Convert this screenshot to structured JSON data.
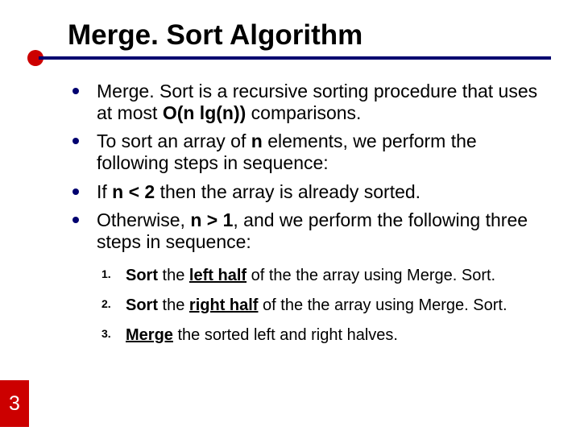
{
  "slide": {
    "number": "3",
    "title": "Merge. Sort Algorithm",
    "bullets": [
      {
        "pre": "Merge. Sort is a recursive sorting procedure that uses at most ",
        "b1": "O(n lg(n))",
        "post": " comparisons."
      },
      {
        "pre": "To sort an array of ",
        "b1": "n",
        "post": " elements, we perform the following steps in sequence:"
      },
      {
        "pre": "If ",
        "b1": "n < 2",
        "post": " then the array is already sorted."
      },
      {
        "pre": "Otherwise, ",
        "b1": "n > 1",
        "post": ", and we perform the following three steps in sequence:"
      }
    ],
    "steps": [
      {
        "num": "1.",
        "b1": "Sort",
        "mid": " the ",
        "bu": "left half",
        "post": " of the the array using Merge. Sort."
      },
      {
        "num": "2.",
        "b1": "Sort",
        "mid": " the ",
        "bu": "right half",
        "post": " of the the array using Merge. Sort."
      },
      {
        "num": "3.",
        "bu": "Merge",
        "post": " the sorted left and right halves."
      }
    ]
  }
}
